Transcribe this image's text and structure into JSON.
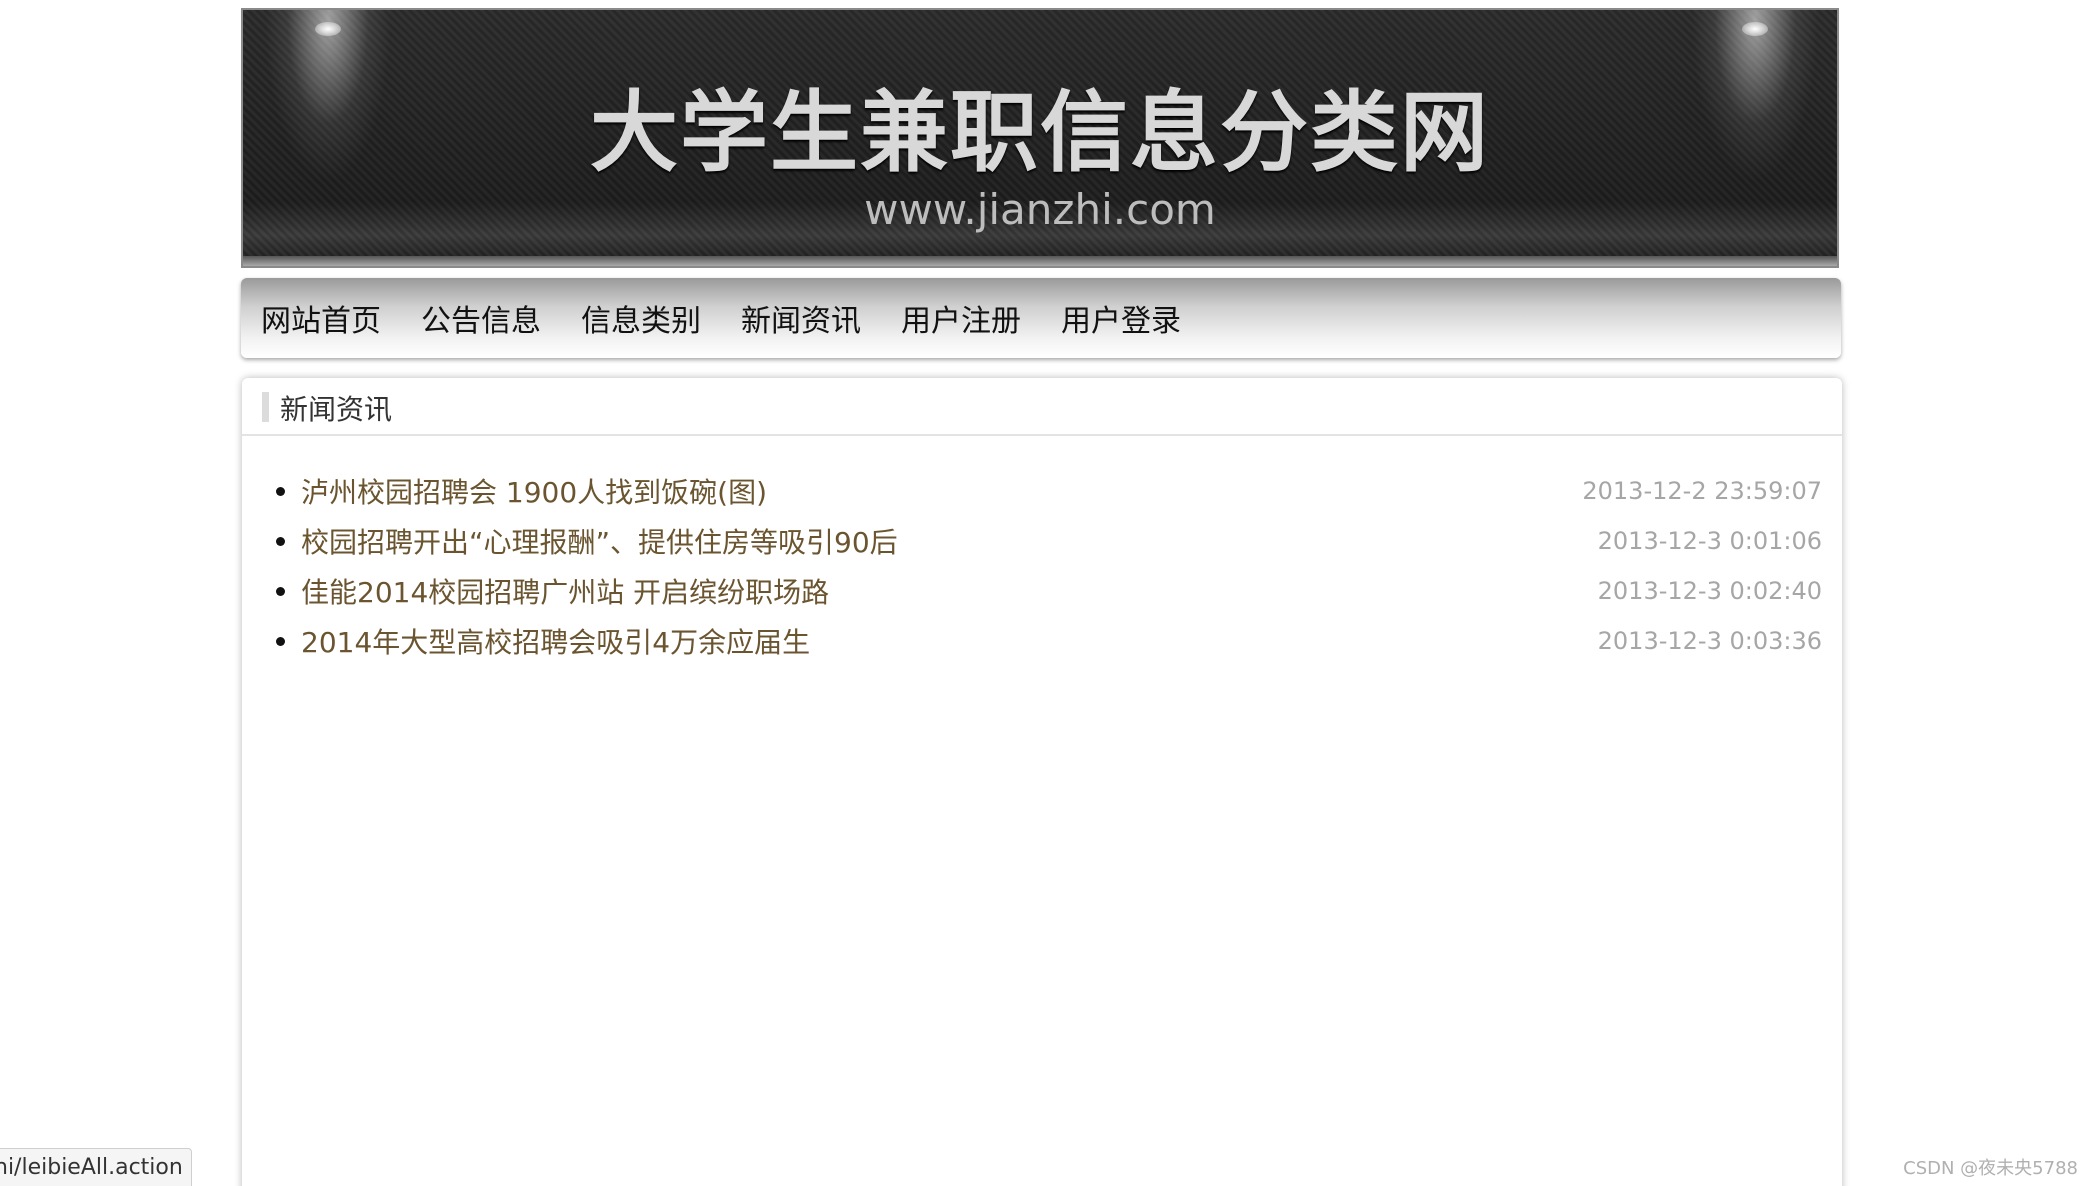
{
  "banner": {
    "title": "大学生兼职信息分类网",
    "url": "www.jianzhi.com"
  },
  "nav": {
    "items": [
      {
        "label": "网站首页"
      },
      {
        "label": "公告信息"
      },
      {
        "label": "信息类别"
      },
      {
        "label": "新闻资讯"
      },
      {
        "label": "用户注册"
      },
      {
        "label": "用户登录"
      }
    ]
  },
  "panel": {
    "title": "新闻资讯",
    "news": [
      {
        "title": "泸州校园招聘会 1900人找到饭碗(图)",
        "date": "2013-12-2 23:59:07"
      },
      {
        "title": "校园招聘开出“心理报酬”、提供住房等吸引90后",
        "date": "2013-12-3 0:01:06"
      },
      {
        "title": "佳能2014校园招聘广州站 开启缤纷职场路",
        "date": "2013-12-3 0:02:40"
      },
      {
        "title": "2014年大型高校招聘会吸引4万余应届生",
        "date": "2013-12-3 0:03:36"
      }
    ]
  },
  "status": {
    "url": "hi/leibieAll.action"
  },
  "watermark": "CSDN @夜未央5788"
}
